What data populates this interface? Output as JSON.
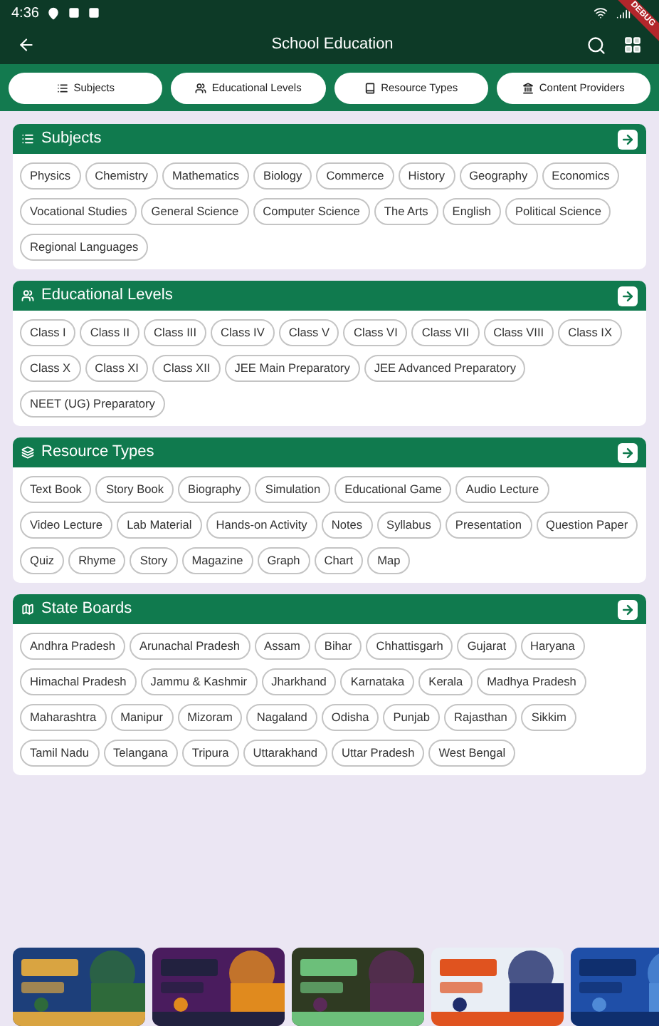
{
  "status_bar": {
    "time": "4:36"
  },
  "debug_ribbon": "DEBUG",
  "app_bar": {
    "title": "School Education"
  },
  "tabs": [
    {
      "label": "Subjects"
    },
    {
      "label": "Educational Levels"
    },
    {
      "label": "Resource Types"
    },
    {
      "label": "Content Providers"
    }
  ],
  "sections": [
    {
      "title": "Subjects",
      "chips": [
        "Physics",
        "Chemistry",
        "Mathematics",
        "Biology",
        "Commerce",
        "History",
        "Geography",
        "Economics",
        "Vocational Studies",
        "General Science",
        "Computer Science",
        "The Arts",
        "English",
        "Political Science",
        "Regional Languages"
      ]
    },
    {
      "title": "Educational Levels",
      "chips": [
        "Class I",
        "Class II",
        "Class III",
        "Class IV",
        "Class V",
        "Class VI",
        "Class VII",
        "Class VIII",
        "Class IX",
        "Class X",
        "Class XI",
        "Class XII",
        "JEE Main Preparatory",
        "JEE Advanced Preparatory",
        "NEET (UG) Preparatory"
      ]
    },
    {
      "title": "Resource Types",
      "chips": [
        "Text Book",
        "Story Book",
        "Biography",
        "Simulation",
        "Educational Game",
        "Audio Lecture",
        "Video Lecture",
        "Lab Material",
        "Hands-on Activity",
        "Notes",
        "Syllabus",
        "Presentation",
        "Question Paper",
        "Quiz",
        "Rhyme",
        "Story",
        "Magazine",
        "Graph",
        "Chart",
        "Map"
      ]
    },
    {
      "title": "State Boards",
      "chips": [
        "Andhra Pradesh",
        "Arunachal Pradesh",
        "Assam",
        "Bihar",
        "Chhattisgarh",
        "Gujarat",
        "Haryana",
        "Himachal Pradesh",
        "Jammu & Kashmir",
        "Jharkhand",
        "Karnataka",
        "Kerala",
        "Madhya Pradesh",
        "Maharashtra",
        "Manipur",
        "Mizoram",
        "Nagaland",
        "Odisha",
        "Punjab",
        "Rajasthan",
        "Sikkim",
        "Tamil Nadu",
        "Telangana",
        "Tripura",
        "Uttarakhand",
        "Uttar Pradesh",
        "West Bengal"
      ]
    }
  ]
}
